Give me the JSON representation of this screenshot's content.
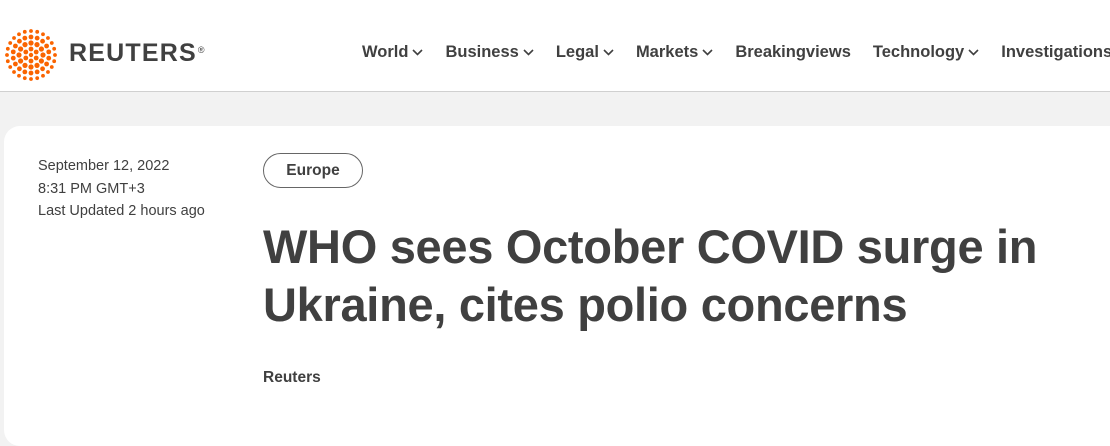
{
  "brand": {
    "name": "REUTERS",
    "reg_mark": "®",
    "logo_color": "#fa6400"
  },
  "nav": {
    "items": [
      {
        "label": "World",
        "has_dropdown": true
      },
      {
        "label": "Business",
        "has_dropdown": true
      },
      {
        "label": "Legal",
        "has_dropdown": true
      },
      {
        "label": "Markets",
        "has_dropdown": true
      },
      {
        "label": "Breakingviews",
        "has_dropdown": false
      },
      {
        "label": "Technology",
        "has_dropdown": true
      },
      {
        "label": "Investigations",
        "has_dropdown": false
      }
    ]
  },
  "article": {
    "date": "September 12, 2022",
    "time": "8:31 PM GMT+3",
    "last_updated": "Last Updated 2 hours ago",
    "section": "Europe",
    "headline": "WHO sees October COVID surge in Ukraine, cites polio concerns",
    "byline": "Reuters"
  }
}
